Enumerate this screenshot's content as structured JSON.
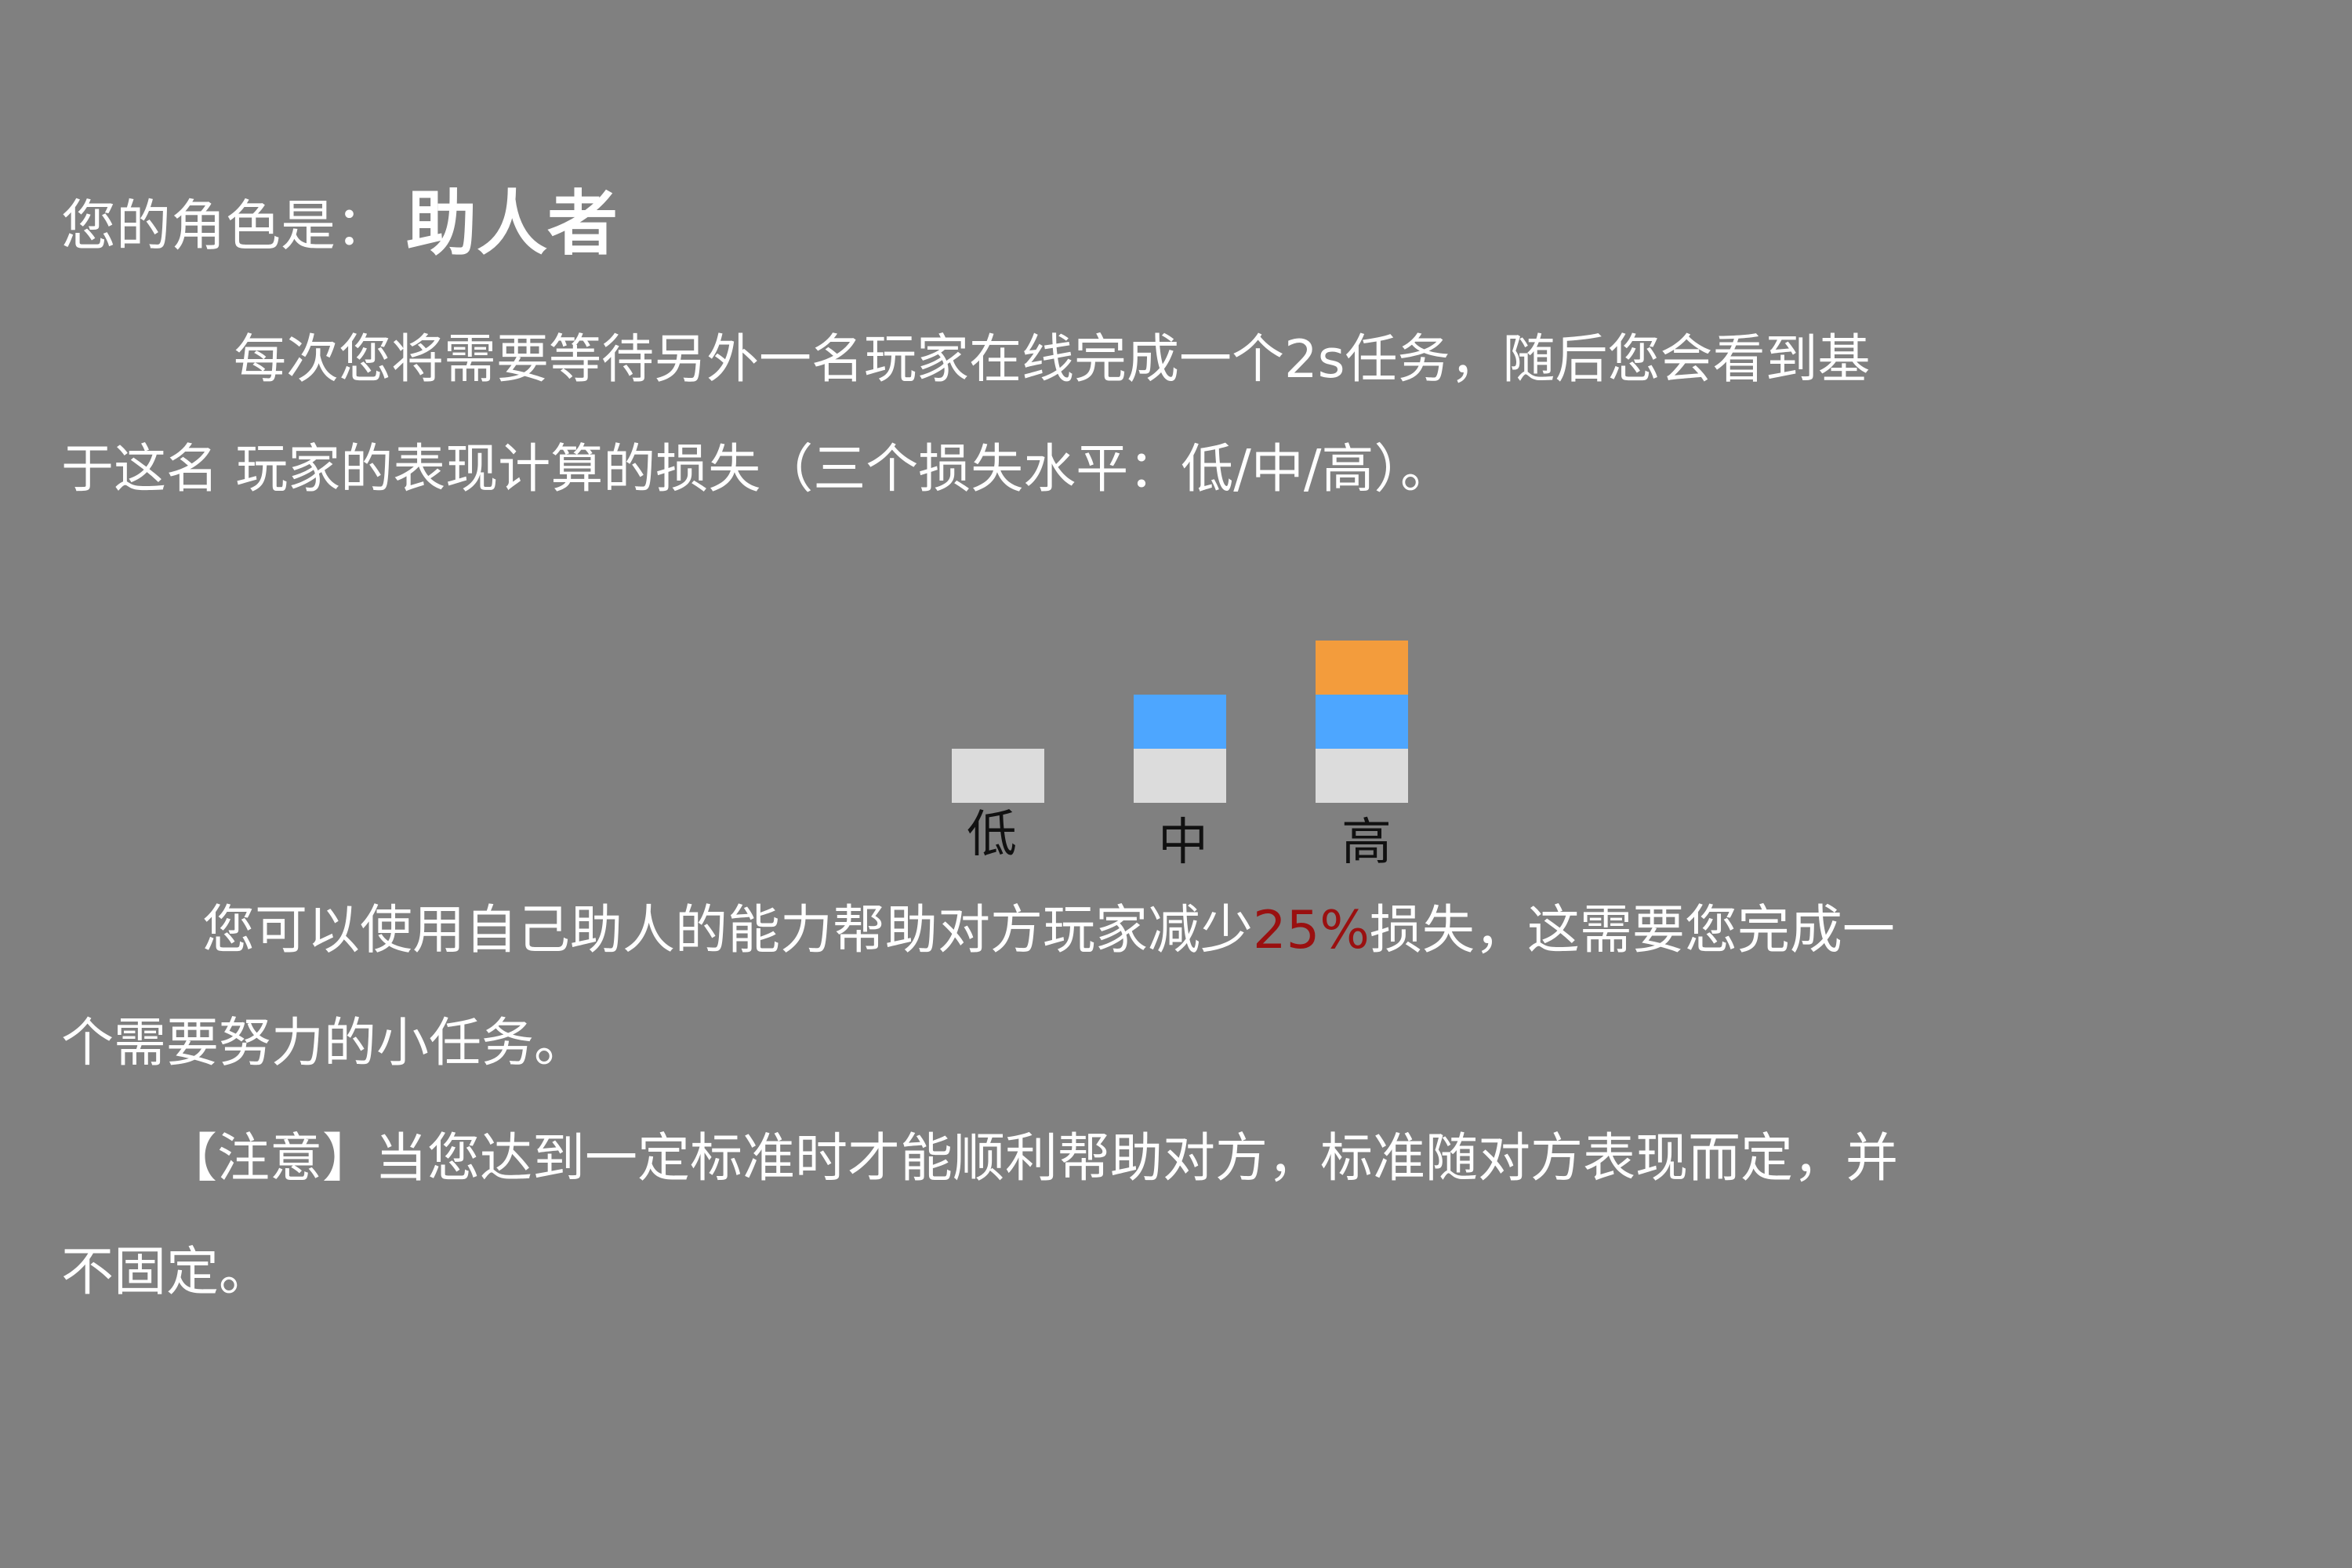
{
  "header": {
    "role_prefix": "您的角色是：",
    "role_name": "助人者"
  },
  "intro": {
    "line1": "每次您将需要等待另外一名玩家在线完成一个2s任务，随后您会看到基",
    "line2": "于这名 玩家的表现计算的损失（三个损失水平：低/中/高）。"
  },
  "loss_levels": {
    "items": [
      {
        "label": "低",
        "blocks": 1
      },
      {
        "label": "中",
        "blocks": 2
      },
      {
        "label": "高",
        "blocks": 3
      }
    ],
    "colors": {
      "base": "#dcdcdc",
      "middle": "#4da6ff",
      "top": "#f39c3c"
    }
  },
  "help": {
    "line1_pre": "您可以使用自己助人的能力帮助对方玩家减少",
    "line1_highlight": "25%",
    "line1_post": "损失，这需要您完成一",
    "line2": "个需要努力的小任务。"
  },
  "note": {
    "line1": "【注意】当您达到一定标准时才能顺利帮助对方，标准随对方表现而定，并",
    "line2": "不固定。"
  },
  "colors": {
    "background": "#808080",
    "text": "#ffffff",
    "highlight": "#9a1010"
  }
}
